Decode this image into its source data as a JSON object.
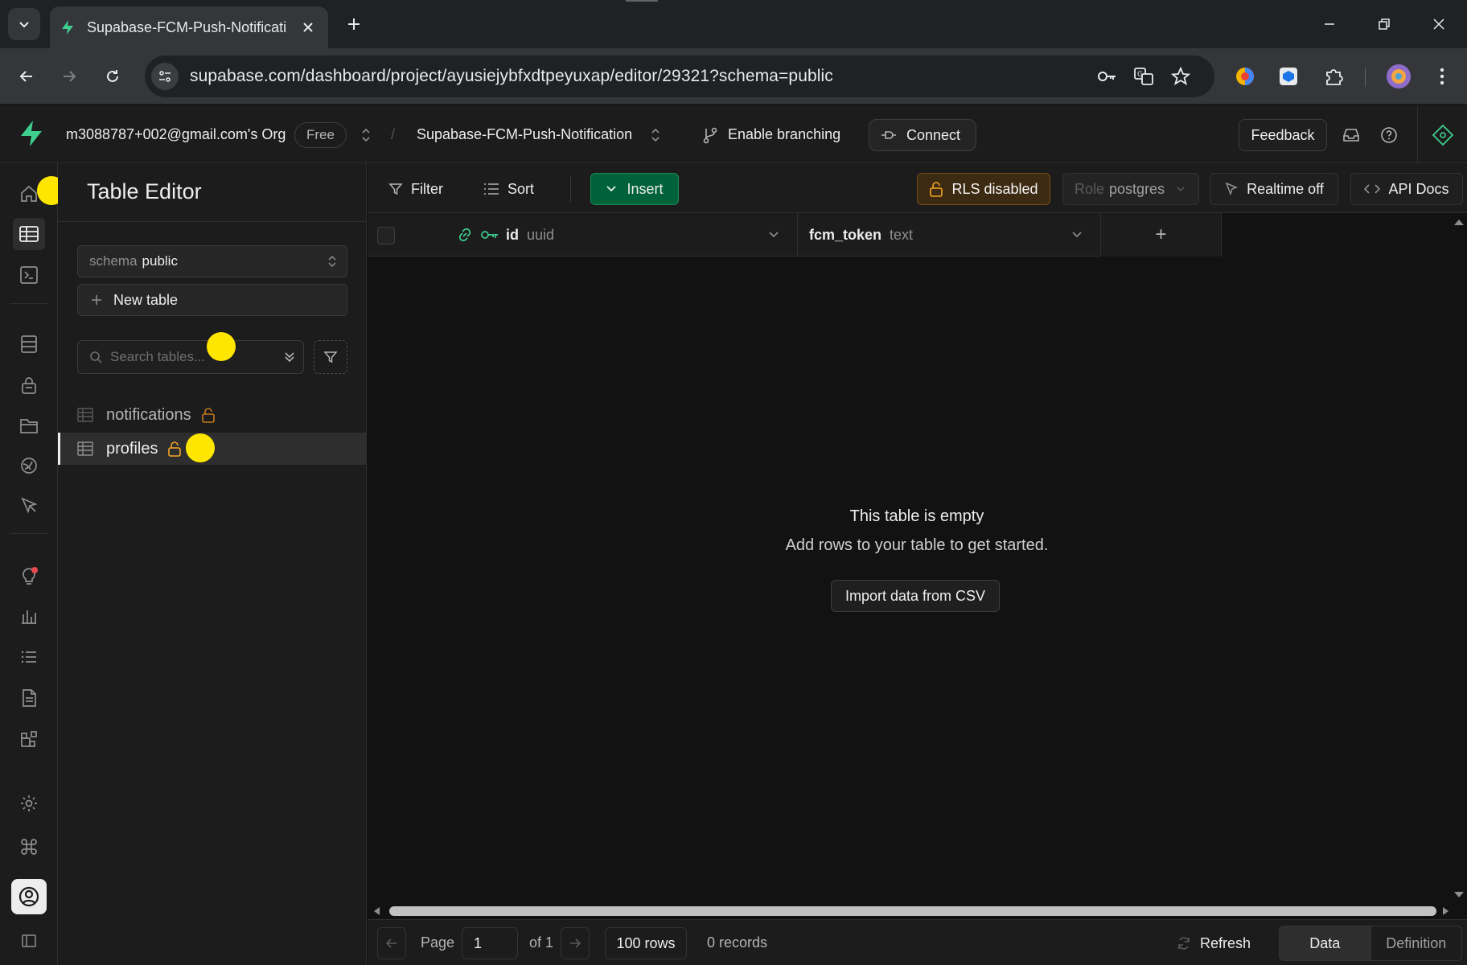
{
  "browser": {
    "tab_title": "Supabase-FCM-Push-Notificati",
    "url": "supabase.com/dashboard/project/ayusiejybfxdtpeyuxap/editor/29321?schema=public"
  },
  "header": {
    "org_name": "m3088787+002@gmail.com's Org",
    "plan": "Free",
    "separator": "/",
    "project_name": "Supabase-FCM-Push-Notification",
    "branching_label": "Enable branching",
    "connect_label": "Connect",
    "feedback_label": "Feedback"
  },
  "sidebar": {
    "title": "Table Editor",
    "schema_label": "schema",
    "schema_value": "public",
    "new_table_label": "New table",
    "search_placeholder": "Search tables...",
    "tables": [
      {
        "name": "notifications"
      },
      {
        "name": "profiles"
      }
    ]
  },
  "toolbar": {
    "filter_label": "Filter",
    "sort_label": "Sort",
    "insert_label": "Insert",
    "rls_label": "RLS disabled",
    "role_label": "Role",
    "role_value": "postgres",
    "realtime_label": "Realtime off",
    "api_docs_label": "API Docs"
  },
  "grid": {
    "columns": [
      {
        "name": "id",
        "type": "uuid"
      },
      {
        "name": "fcm_token",
        "type": "text"
      }
    ],
    "add_column": "+",
    "empty_title": "This table is empty",
    "empty_subtitle": "Add rows to your table to get started.",
    "import_label": "Import data from CSV"
  },
  "footer": {
    "page_label": "Page",
    "page_value": "1",
    "of_label": "of 1",
    "rows_label": "100 rows",
    "records_label": "0 records",
    "refresh_label": "Refresh",
    "data_tab": "Data",
    "definition_tab": "Definition"
  },
  "colors": {
    "brand_green": "#3ecf8e",
    "insert_bg": "#006239",
    "rls_warning": "#f5a623",
    "marker_yellow": "#ffe600"
  }
}
